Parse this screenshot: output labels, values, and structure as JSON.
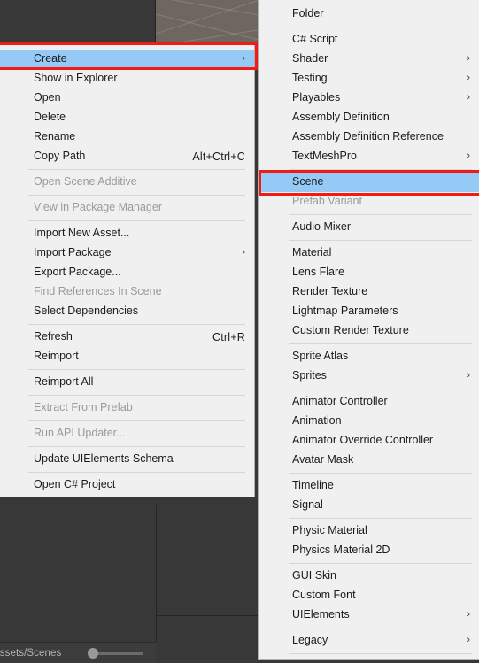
{
  "app": {
    "name": "Unity Editor",
    "status_path": "Assets/Scenes"
  },
  "colors": {
    "menu_background": "#f0f0f0",
    "menu_border": "#b0b0b0",
    "highlight_blue": "#94caf5",
    "annotation_red": "#ee1b16",
    "editor_dark": "#383838",
    "scene_view": "#6e6760",
    "disabled_text": "#9a9a9a",
    "text": "#1a1a1a"
  },
  "context_menu": {
    "name": "project-context-menu",
    "items": [
      {
        "label": "Create",
        "shortcut": "",
        "submenu": true,
        "disabled": false,
        "selected": true,
        "separator_after": false
      },
      {
        "label": "Show in Explorer",
        "shortcut": "",
        "submenu": false,
        "disabled": false,
        "selected": false,
        "separator_after": false
      },
      {
        "label": "Open",
        "shortcut": "",
        "submenu": false,
        "disabled": false,
        "selected": false,
        "separator_after": false
      },
      {
        "label": "Delete",
        "shortcut": "",
        "submenu": false,
        "disabled": false,
        "selected": false,
        "separator_after": false
      },
      {
        "label": "Rename",
        "shortcut": "",
        "submenu": false,
        "disabled": false,
        "selected": false,
        "separator_after": false
      },
      {
        "label": "Copy Path",
        "shortcut": "Alt+Ctrl+C",
        "submenu": false,
        "disabled": false,
        "selected": false,
        "separator_after": true
      },
      {
        "label": "Open Scene Additive",
        "shortcut": "",
        "submenu": false,
        "disabled": true,
        "selected": false,
        "separator_after": true
      },
      {
        "label": "View in Package Manager",
        "shortcut": "",
        "submenu": false,
        "disabled": true,
        "selected": false,
        "separator_after": true
      },
      {
        "label": "Import New Asset...",
        "shortcut": "",
        "submenu": false,
        "disabled": false,
        "selected": false,
        "separator_after": false
      },
      {
        "label": "Import Package",
        "shortcut": "",
        "submenu": true,
        "disabled": false,
        "selected": false,
        "separator_after": false
      },
      {
        "label": "Export Package...",
        "shortcut": "",
        "submenu": false,
        "disabled": false,
        "selected": false,
        "separator_after": false
      },
      {
        "label": "Find References In Scene",
        "shortcut": "",
        "submenu": false,
        "disabled": true,
        "selected": false,
        "separator_after": false
      },
      {
        "label": "Select Dependencies",
        "shortcut": "",
        "submenu": false,
        "disabled": false,
        "selected": false,
        "separator_after": true
      },
      {
        "label": "Refresh",
        "shortcut": "Ctrl+R",
        "submenu": false,
        "disabled": false,
        "selected": false,
        "separator_after": false
      },
      {
        "label": "Reimport",
        "shortcut": "",
        "submenu": false,
        "disabled": false,
        "selected": false,
        "separator_after": true
      },
      {
        "label": "Reimport All",
        "shortcut": "",
        "submenu": false,
        "disabled": false,
        "selected": false,
        "separator_after": true
      },
      {
        "label": "Extract From Prefab",
        "shortcut": "",
        "submenu": false,
        "disabled": true,
        "selected": false,
        "separator_after": true
      },
      {
        "label": "Run API Updater...",
        "shortcut": "",
        "submenu": false,
        "disabled": true,
        "selected": false,
        "separator_after": true
      },
      {
        "label": "Update UIElements Schema",
        "shortcut": "",
        "submenu": false,
        "disabled": false,
        "selected": false,
        "separator_after": true
      },
      {
        "label": "Open C# Project",
        "shortcut": "",
        "submenu": false,
        "disabled": false,
        "selected": false,
        "separator_after": false
      }
    ]
  },
  "create_submenu": {
    "name": "create-submenu",
    "items": [
      {
        "label": "Folder",
        "submenu": false,
        "disabled": false,
        "selected": false,
        "separator_after": true
      },
      {
        "label": "C# Script",
        "submenu": false,
        "disabled": false,
        "selected": false,
        "separator_after": false
      },
      {
        "label": "Shader",
        "submenu": true,
        "disabled": false,
        "selected": false,
        "separator_after": false
      },
      {
        "label": "Testing",
        "submenu": true,
        "disabled": false,
        "selected": false,
        "separator_after": false
      },
      {
        "label": "Playables",
        "submenu": true,
        "disabled": false,
        "selected": false,
        "separator_after": false
      },
      {
        "label": "Assembly Definition",
        "submenu": false,
        "disabled": false,
        "selected": false,
        "separator_after": false
      },
      {
        "label": "Assembly Definition Reference",
        "submenu": false,
        "disabled": false,
        "selected": false,
        "separator_after": false
      },
      {
        "label": "TextMeshPro",
        "submenu": true,
        "disabled": false,
        "selected": false,
        "separator_after": true
      },
      {
        "label": "Scene",
        "submenu": false,
        "disabled": false,
        "selected": true,
        "separator_after": false
      },
      {
        "label": "Prefab Variant",
        "submenu": false,
        "disabled": true,
        "selected": false,
        "separator_after": true
      },
      {
        "label": "Audio Mixer",
        "submenu": false,
        "disabled": false,
        "selected": false,
        "separator_after": true
      },
      {
        "label": "Material",
        "submenu": false,
        "disabled": false,
        "selected": false,
        "separator_after": false
      },
      {
        "label": "Lens Flare",
        "submenu": false,
        "disabled": false,
        "selected": false,
        "separator_after": false
      },
      {
        "label": "Render Texture",
        "submenu": false,
        "disabled": false,
        "selected": false,
        "separator_after": false
      },
      {
        "label": "Lightmap Parameters",
        "submenu": false,
        "disabled": false,
        "selected": false,
        "separator_after": false
      },
      {
        "label": "Custom Render Texture",
        "submenu": false,
        "disabled": false,
        "selected": false,
        "separator_after": true
      },
      {
        "label": "Sprite Atlas",
        "submenu": false,
        "disabled": false,
        "selected": false,
        "separator_after": false
      },
      {
        "label": "Sprites",
        "submenu": true,
        "disabled": false,
        "selected": false,
        "separator_after": true
      },
      {
        "label": "Animator Controller",
        "submenu": false,
        "disabled": false,
        "selected": false,
        "separator_after": false
      },
      {
        "label": "Animation",
        "submenu": false,
        "disabled": false,
        "selected": false,
        "separator_after": false
      },
      {
        "label": "Animator Override Controller",
        "submenu": false,
        "disabled": false,
        "selected": false,
        "separator_after": false
      },
      {
        "label": "Avatar Mask",
        "submenu": false,
        "disabled": false,
        "selected": false,
        "separator_after": true
      },
      {
        "label": "Timeline",
        "submenu": false,
        "disabled": false,
        "selected": false,
        "separator_after": false
      },
      {
        "label": "Signal",
        "submenu": false,
        "disabled": false,
        "selected": false,
        "separator_after": true
      },
      {
        "label": "Physic Material",
        "submenu": false,
        "disabled": false,
        "selected": false,
        "separator_after": false
      },
      {
        "label": "Physics Material 2D",
        "submenu": false,
        "disabled": false,
        "selected": false,
        "separator_after": true
      },
      {
        "label": "GUI Skin",
        "submenu": false,
        "disabled": false,
        "selected": false,
        "separator_after": false
      },
      {
        "label": "Custom Font",
        "submenu": false,
        "disabled": false,
        "selected": false,
        "separator_after": false
      },
      {
        "label": "UIElements",
        "submenu": true,
        "disabled": false,
        "selected": false,
        "separator_after": true
      },
      {
        "label": "Legacy",
        "submenu": true,
        "disabled": false,
        "selected": false,
        "separator_after": true
      }
    ]
  },
  "annotations": [
    {
      "name": "create-highlight-box",
      "target": "Create"
    },
    {
      "name": "scene-highlight-box",
      "target": "Scene"
    }
  ],
  "icons": {
    "submenu_arrow": "chevron-right-icon"
  }
}
